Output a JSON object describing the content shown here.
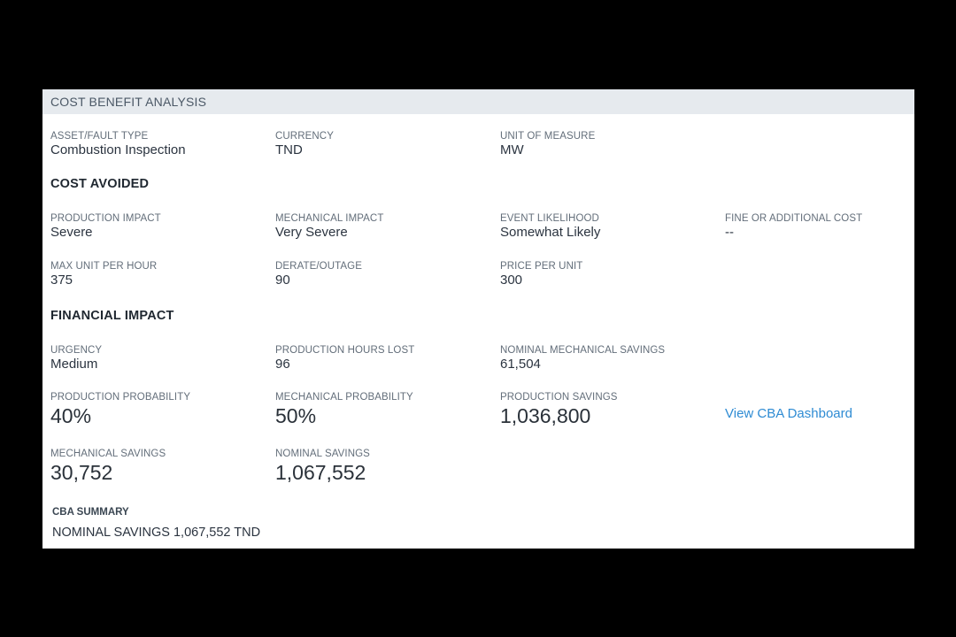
{
  "panel": {
    "title": "COST BENEFIT ANALYSIS"
  },
  "general": {
    "asset_fault_type": {
      "label": "ASSET/FAULT TYPE",
      "value": "Combustion Inspection"
    },
    "currency": {
      "label": "CURRENCY",
      "value": "TND"
    },
    "unit_of_measure": {
      "label": "UNIT OF MEASURE",
      "value": "MW"
    }
  },
  "cost_avoided": {
    "title": "COST AVOIDED",
    "production_impact": {
      "label": "PRODUCTION IMPACT",
      "value": "Severe"
    },
    "mechanical_impact": {
      "label": "MECHANICAL IMPACT",
      "value": "Very Severe"
    },
    "event_likelihood": {
      "label": "EVENT LIKELIHOOD",
      "value": "Somewhat Likely"
    },
    "fine_or_additional_cost": {
      "label": "FINE OR ADDITIONAL COST",
      "value": "--"
    },
    "max_unit_per_hour": {
      "label": "MAX UNIT PER HOUR",
      "value": "375"
    },
    "derate_outage": {
      "label": "DERATE/OUTAGE",
      "value": "90"
    },
    "price_per_unit": {
      "label": "PRICE PER UNIT",
      "value": "300"
    }
  },
  "financial_impact": {
    "title": "FINANCIAL IMPACT",
    "urgency": {
      "label": "URGENCY",
      "value": "Medium"
    },
    "production_hours_lost": {
      "label": "PRODUCTION HOURS LOST",
      "value": "96"
    },
    "nominal_mechanical_savings": {
      "label": "NOMINAL MECHANICAL SAVINGS",
      "value": "61,504"
    },
    "production_probability": {
      "label": "PRODUCTION PROBABILITY",
      "value": "40%"
    },
    "mechanical_probability": {
      "label": "MECHANICAL PROBABILITY",
      "value": "50%"
    },
    "production_savings": {
      "label": "PRODUCTION SAVINGS",
      "value": "1,036,800"
    },
    "view_dashboard_link": "View CBA Dashboard",
    "mechanical_savings": {
      "label": "MECHANICAL SAVINGS",
      "value": "30,752"
    },
    "nominal_savings": {
      "label": "NOMINAL SAVINGS",
      "value": "1,067,552"
    }
  },
  "summary": {
    "label": "CBA SUMMARY",
    "text": "NOMINAL SAVINGS 1,067,552 TND"
  },
  "colors": {
    "background": "#000000",
    "panel": "#ffffff",
    "header": "#e6eaee",
    "link": "#2e8bd3"
  }
}
